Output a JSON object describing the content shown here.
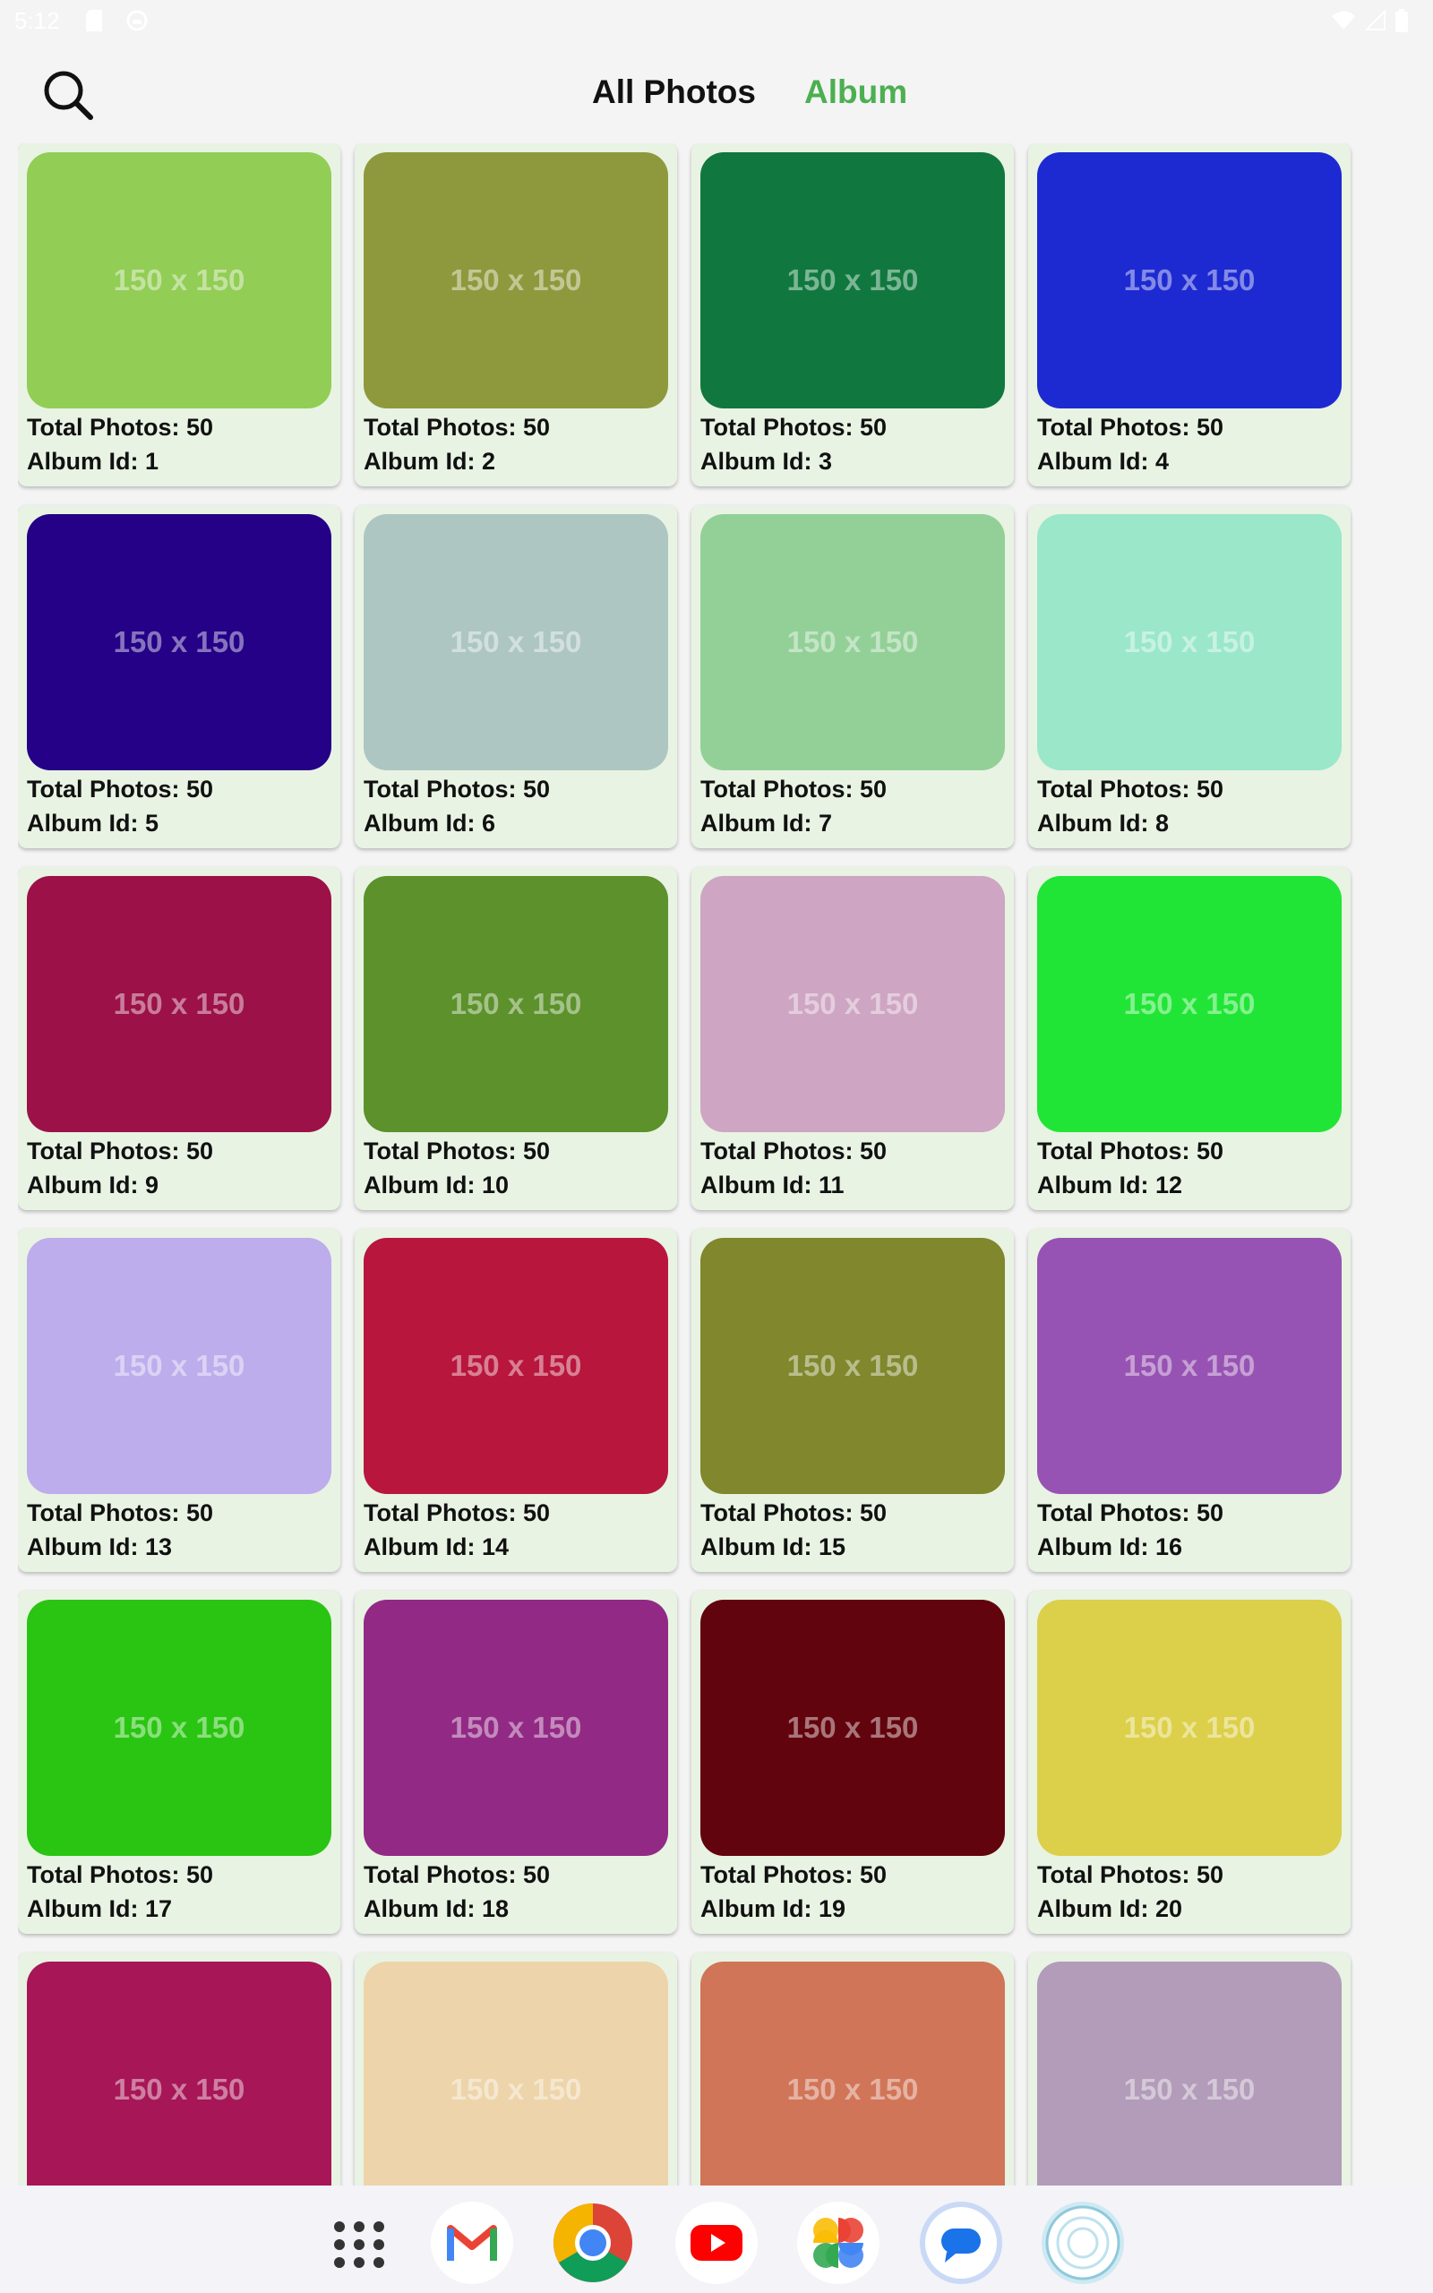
{
  "status_bar": {
    "time": "5:12",
    "left_icons": [
      "sd-card-icon",
      "notification-icon"
    ],
    "right_icons": [
      "wifi-icon",
      "signal-icon",
      "battery-icon"
    ]
  },
  "header": {
    "search_icon": "search-icon",
    "tabs": [
      {
        "label": "All Photos",
        "active": false,
        "color": "#111111"
      },
      {
        "label": "Album",
        "active": true,
        "color": "#4caf50"
      }
    ]
  },
  "albums": [
    {
      "total": "Total Photos: 50",
      "id": "Album Id: 1",
      "placeholder": "150 x 150",
      "color": "#92cd55"
    },
    {
      "total": "Total Photos: 50",
      "id": "Album Id: 2",
      "placeholder": "150 x 150",
      "color": "#8e993d"
    },
    {
      "total": "Total Photos: 50",
      "id": "Album Id: 3",
      "placeholder": "150 x 150",
      "color": "#10783e"
    },
    {
      "total": "Total Photos: 50",
      "id": "Album Id: 4",
      "placeholder": "150 x 150",
      "color": "#1d2ad1"
    },
    {
      "total": "Total Photos: 50",
      "id": "Album Id: 5",
      "placeholder": "150 x 150",
      "color": "#240187"
    },
    {
      "total": "Total Photos: 50",
      "id": "Album Id: 6",
      "placeholder": "150 x 150",
      "color": "#adc6c1"
    },
    {
      "total": "Total Photos: 50",
      "id": "Album Id: 7",
      "placeholder": "150 x 150",
      "color": "#93d098"
    },
    {
      "total": "Total Photos: 50",
      "id": "Album Id: 8",
      "placeholder": "150 x 150",
      "color": "#9ae7c9"
    },
    {
      "total": "Total Photos: 50",
      "id": "Album Id: 9",
      "placeholder": "150 x 150",
      "color": "#9b1148"
    },
    {
      "total": "Total Photos: 50",
      "id": "Album Id: 10",
      "placeholder": "150 x 150",
      "color": "#5c912b"
    },
    {
      "total": "Total Photos: 50",
      "id": "Album Id: 11",
      "placeholder": "150 x 150",
      "color": "#cea5c2"
    },
    {
      "total": "Total Photos: 50",
      "id": "Album Id: 12",
      "placeholder": "150 x 150",
      "color": "#21e536"
    },
    {
      "total": "Total Photos: 50",
      "id": "Album Id: 13",
      "placeholder": "150 x 150",
      "color": "#bdadec"
    },
    {
      "total": "Total Photos: 50",
      "id": "Album Id: 14",
      "placeholder": "150 x 150",
      "color": "#b8163d"
    },
    {
      "total": "Total Photos: 50",
      "id": "Album Id: 15",
      "placeholder": "150 x 150",
      "color": "#80872c"
    },
    {
      "total": "Total Photos: 50",
      "id": "Album Id: 16",
      "placeholder": "150 x 150",
      "color": "#9753b3"
    },
    {
      "total": "Total Photos: 50",
      "id": "Album Id: 17",
      "placeholder": "150 x 150",
      "color": "#2ac512"
    },
    {
      "total": "Total Photos: 50",
      "id": "Album Id: 18",
      "placeholder": "150 x 150",
      "color": "#922a85"
    },
    {
      "total": "Total Photos: 50",
      "id": "Album Id: 19",
      "placeholder": "150 x 150",
      "color": "#62040d"
    },
    {
      "total": "Total Photos: 50",
      "id": "Album Id: 20",
      "placeholder": "150 x 150",
      "color": "#dccf4a"
    },
    {
      "total": "",
      "id": "",
      "placeholder": "150 x 150",
      "color": "#a71657"
    },
    {
      "total": "",
      "id": "",
      "placeholder": "150 x 150",
      "color": "#edd4aa"
    },
    {
      "total": "",
      "id": "",
      "placeholder": "150 x 150",
      "color": "#d17558"
    },
    {
      "total": "",
      "id": "",
      "placeholder": "150 x 150",
      "color": "#b29cb9"
    }
  ],
  "dock": [
    {
      "name": "app-drawer-icon"
    },
    {
      "name": "gmail-icon"
    },
    {
      "name": "chrome-icon"
    },
    {
      "name": "youtube-icon"
    },
    {
      "name": "photos-icon"
    },
    {
      "name": "messages-icon"
    },
    {
      "name": "assistant-icon"
    }
  ]
}
